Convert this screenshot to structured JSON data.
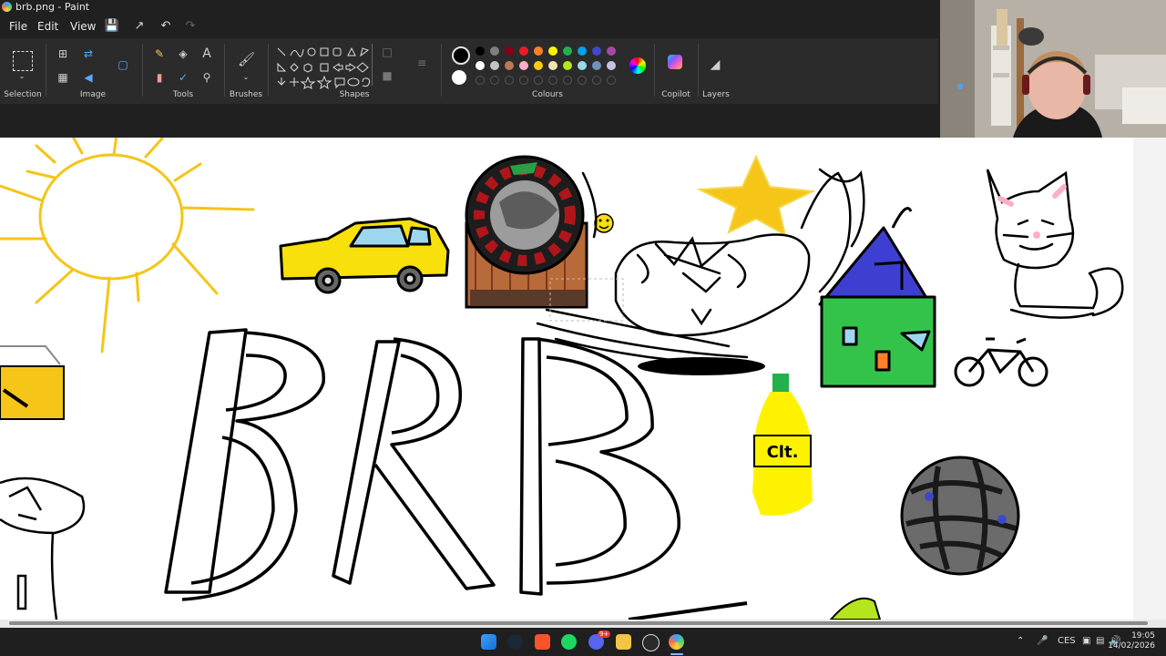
{
  "window": {
    "title": "brb.png - Paint"
  },
  "menu": {
    "file": "File",
    "edit": "Edit",
    "view": "View"
  },
  "ribbon": {
    "selection": "Selection",
    "image": "Image",
    "tools": "Tools",
    "brushes": "Brushes",
    "shapes": "Shapes",
    "colours": "Colours",
    "copilot": "Copilot",
    "layers": "Layers",
    "text_tool": "A"
  },
  "palette": {
    "row1": [
      "#000000",
      "#7f7f7f",
      "#880015",
      "#ed1c24",
      "#ff7f27",
      "#fff200",
      "#22b14c",
      "#00a2e8",
      "#3f48cc",
      "#a349a4"
    ],
    "row2": [
      "#ffffff",
      "#c3c3c3",
      "#b97a57",
      "#ffaec9",
      "#ffc90e",
      "#efe4b0",
      "#b5e61d",
      "#99d9ea",
      "#7092be",
      "#c8bfe7"
    ],
    "primary": "#000000",
    "secondary": "#ffffff"
  },
  "canvas": {
    "bottle_label": "Clt."
  },
  "taskbar": {
    "lang": "CES",
    "time": "19:05",
    "date": "14/02/2026",
    "discord_badge": "9+"
  }
}
